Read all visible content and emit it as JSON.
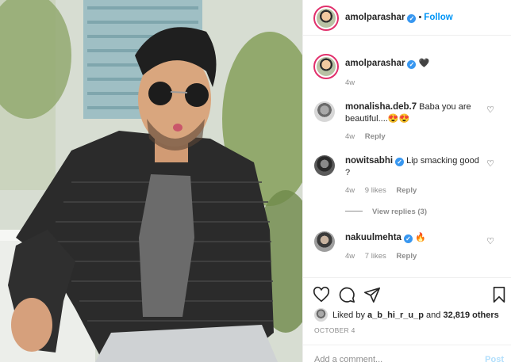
{
  "header": {
    "username": "amolparashar",
    "dot": "•",
    "follow_label": "Follow"
  },
  "comments": [
    {
      "username": "amolparashar",
      "text": "🖤",
      "time": "4w"
    },
    {
      "username": "monalisha.deb.7",
      "text": "Baba you are beautiful....😍😍",
      "time": "4w",
      "reply_label": "Reply"
    },
    {
      "username": "nowitsabhi",
      "text": "Lip smacking good ?",
      "time": "4w",
      "likes": "9 likes",
      "reply_label": "Reply",
      "view_replies": "View replies (3)"
    },
    {
      "username": "nakuulmehta",
      "text": "🔥",
      "time": "4w",
      "likes": "7 likes",
      "reply_label": "Reply"
    }
  ],
  "actions": {
    "liked_by_prefix": "Liked by",
    "liked_by_user": "a_b_hi_r_u_p",
    "liked_by_suffix": "and",
    "others": "32,819 others",
    "date": "OCTOBER 4"
  },
  "add_comment": {
    "placeholder": "Add a comment...",
    "post_label": "Post"
  },
  "colors": {
    "accent": "#0095f6",
    "verified": "#3897f0",
    "muted": "#8e8e8e",
    "text": "#262626",
    "post_disabled": "#b2dffc"
  },
  "icons": [
    "heart-icon",
    "comment-icon",
    "share-icon",
    "bookmark-icon",
    "verified-badge-icon"
  ]
}
